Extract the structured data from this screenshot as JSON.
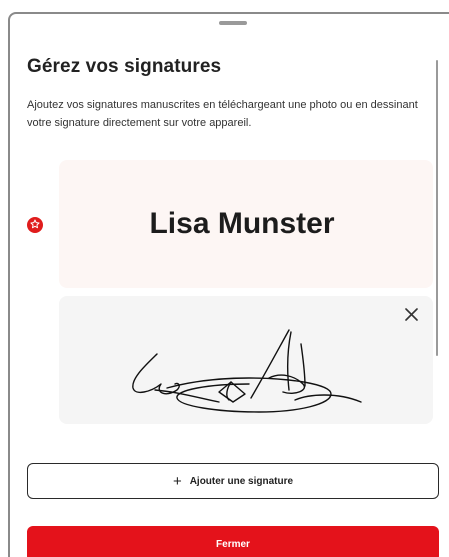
{
  "dialog": {
    "title": "Gérez vos signatures",
    "description": "Ajoutez vos signatures manuscrites en téléchargeant une photo ou en dessinant votre signature directement sur votre appareil."
  },
  "signatures": [
    {
      "type": "typed",
      "name": "Lisa Munster",
      "is_default": true,
      "icon": "star-icon"
    },
    {
      "type": "drawn",
      "icon": "close-icon"
    }
  ],
  "actions": {
    "add_label": "Ajouter une signature",
    "add_icon": "plus-icon",
    "close_label": "Fermer"
  },
  "colors": {
    "accent": "#e4121b",
    "typed_card_bg": "#fdf6f4",
    "drawn_card_bg": "#f5f5f5"
  }
}
